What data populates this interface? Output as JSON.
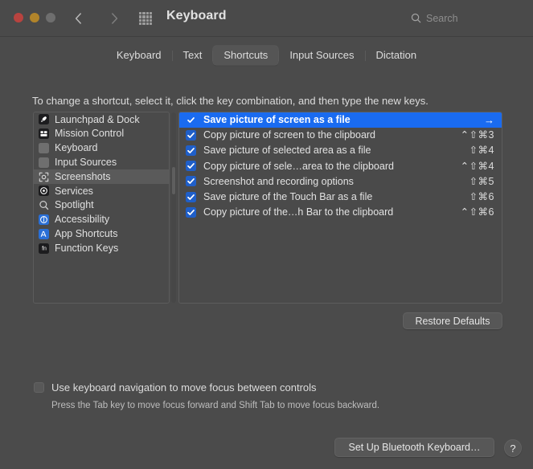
{
  "window": {
    "title": "Keyboard",
    "traffic_lights": [
      "close",
      "minimize",
      "zoom"
    ],
    "back_icon": "chevron-left-icon",
    "forward_icon": "chevron-right-icon",
    "grid_icon": "grid-apps-icon"
  },
  "search": {
    "placeholder": "Search",
    "icon": "search-icon"
  },
  "tabs": [
    {
      "label": "Keyboard",
      "active": false
    },
    {
      "label": "Text",
      "active": false
    },
    {
      "label": "Shortcuts",
      "active": true
    },
    {
      "label": "Input Sources",
      "active": false
    },
    {
      "label": "Dictation",
      "active": false
    }
  ],
  "instruction": "To change a shortcut, select it, click the key combination, and then type the new keys.",
  "sidebar": {
    "items": [
      {
        "label": "Launchpad & Dock",
        "icon": "launchpad-icon",
        "icon_style": "dark",
        "selected": false
      },
      {
        "label": "Mission Control",
        "icon": "mission-control-icon",
        "icon_style": "dark",
        "selected": false
      },
      {
        "label": "Keyboard",
        "icon": "keyboard-icon",
        "icon_style": "blank",
        "selected": false
      },
      {
        "label": "Input Sources",
        "icon": "input-sources-icon",
        "icon_style": "blank",
        "selected": false
      },
      {
        "label": "Screenshots",
        "icon": "camera-icon",
        "icon_style": "plain",
        "selected": true
      },
      {
        "label": "Services",
        "icon": "services-icon",
        "icon_style": "dark",
        "selected": false
      },
      {
        "label": "Spotlight",
        "icon": "spotlight-icon",
        "icon_style": "plain",
        "selected": false
      },
      {
        "label": "Accessibility",
        "icon": "accessibility-icon",
        "icon_style": "blue",
        "selected": false
      },
      {
        "label": "App Shortcuts",
        "icon": "app-shortcuts-icon",
        "icon_style": "blue",
        "selected": false
      },
      {
        "label": "Function Keys",
        "icon": "fn-key-icon",
        "icon_style": "dark",
        "selected": false
      }
    ]
  },
  "shortcuts": {
    "rows": [
      {
        "label": "Save picture of screen as a file",
        "keys": "",
        "checked": true,
        "selected": true,
        "arrow": "→"
      },
      {
        "label": "Copy picture of screen to the clipboard",
        "keys": "⌃⇧⌘3",
        "checked": true,
        "selected": false,
        "arrow": ""
      },
      {
        "label": "Save picture of selected area as a file",
        "keys": "⇧⌘4",
        "checked": true,
        "selected": false,
        "arrow": ""
      },
      {
        "label": "Copy picture of sele…area to the clipboard",
        "keys": "⌃⇧⌘4",
        "checked": true,
        "selected": false,
        "arrow": ""
      },
      {
        "label": "Screenshot and recording options",
        "keys": "⇧⌘5",
        "checked": true,
        "selected": false,
        "arrow": ""
      },
      {
        "label": "Save picture of the Touch Bar as a file",
        "keys": "⇧⌘6",
        "checked": true,
        "selected": false,
        "arrow": ""
      },
      {
        "label": "Copy picture of the…h Bar to the clipboard",
        "keys": "⌃⇧⌘6",
        "checked": true,
        "selected": false,
        "arrow": ""
      }
    ]
  },
  "buttons": {
    "restore_defaults": "Restore Defaults",
    "bluetooth": "Set Up Bluetooth Keyboard…",
    "help": "?"
  },
  "keyboard_nav": {
    "label": "Use keyboard navigation to move focus between controls",
    "hint": "Press the Tab key to move focus forward and Shift Tab to move focus backward.",
    "checked": false
  },
  "colors": {
    "accent_blue": "#1a6bf0",
    "checkbox_blue": "#1f5fc9",
    "window_bg": "#4b4b4b",
    "panel_bg": "#4a4a4a"
  }
}
